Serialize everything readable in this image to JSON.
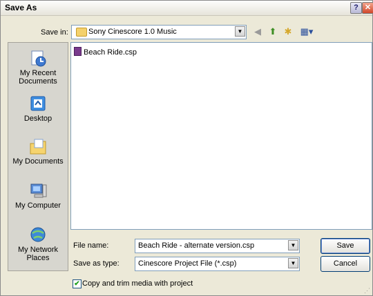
{
  "window": {
    "title": "Save As",
    "help_label": "?",
    "close_label": "✕"
  },
  "save_in": {
    "label": "Save in:",
    "value": "Sony Cinescore 1.0 Music"
  },
  "toolbar": {
    "back_icon": "back-icon",
    "up_icon": "up-folder-icon",
    "new_folder_icon": "new-folder-icon",
    "views_icon": "views-menu-icon"
  },
  "places": [
    {
      "label": "My Recent Documents",
      "icon": "recent-documents-icon"
    },
    {
      "label": "Desktop",
      "icon": "desktop-icon"
    },
    {
      "label": "My Documents",
      "icon": "my-documents-icon"
    },
    {
      "label": "My Computer",
      "icon": "my-computer-icon"
    },
    {
      "label": "My Network Places",
      "icon": "network-places-icon"
    }
  ],
  "files": [
    {
      "name": "Beach Ride.csp"
    }
  ],
  "file_name": {
    "label": "File name:",
    "value": "Beach Ride - alternate version.csp"
  },
  "save_as_type": {
    "label": "Save as type:",
    "value": "Cinescore Project File (*.csp)"
  },
  "buttons": {
    "save": "Save",
    "cancel": "Cancel"
  },
  "copy_option": {
    "label": "Copy and trim media with project",
    "checked": true
  },
  "colors": {
    "dialog_bg": "#ece9d8",
    "close_red": "#d1472a",
    "field_border": "#7f9db9"
  }
}
